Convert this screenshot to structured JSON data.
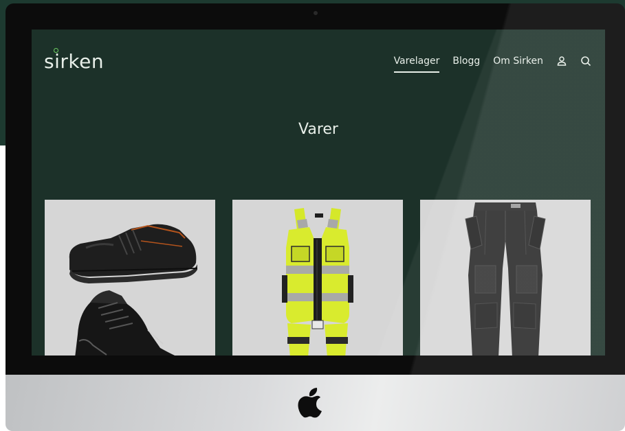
{
  "site": {
    "logo_text": "sirken"
  },
  "nav": {
    "items": [
      {
        "label": "Varelager",
        "active": true
      },
      {
        "label": "Blogg",
        "active": false
      },
      {
        "label": "Om Sirken",
        "active": false
      }
    ],
    "icons": [
      "user-icon",
      "search-icon"
    ]
  },
  "page": {
    "title": "Varer"
  },
  "products": [
    {
      "image": "safety-shoes"
    },
    {
      "image": "hi-vis-vest"
    },
    {
      "image": "work-trousers"
    }
  ],
  "colors": {
    "screen_bg": "#1c3129",
    "accent_green": "#6fcf63",
    "text_light": "#e8efe9",
    "card_bg": "#d6d6d6"
  }
}
